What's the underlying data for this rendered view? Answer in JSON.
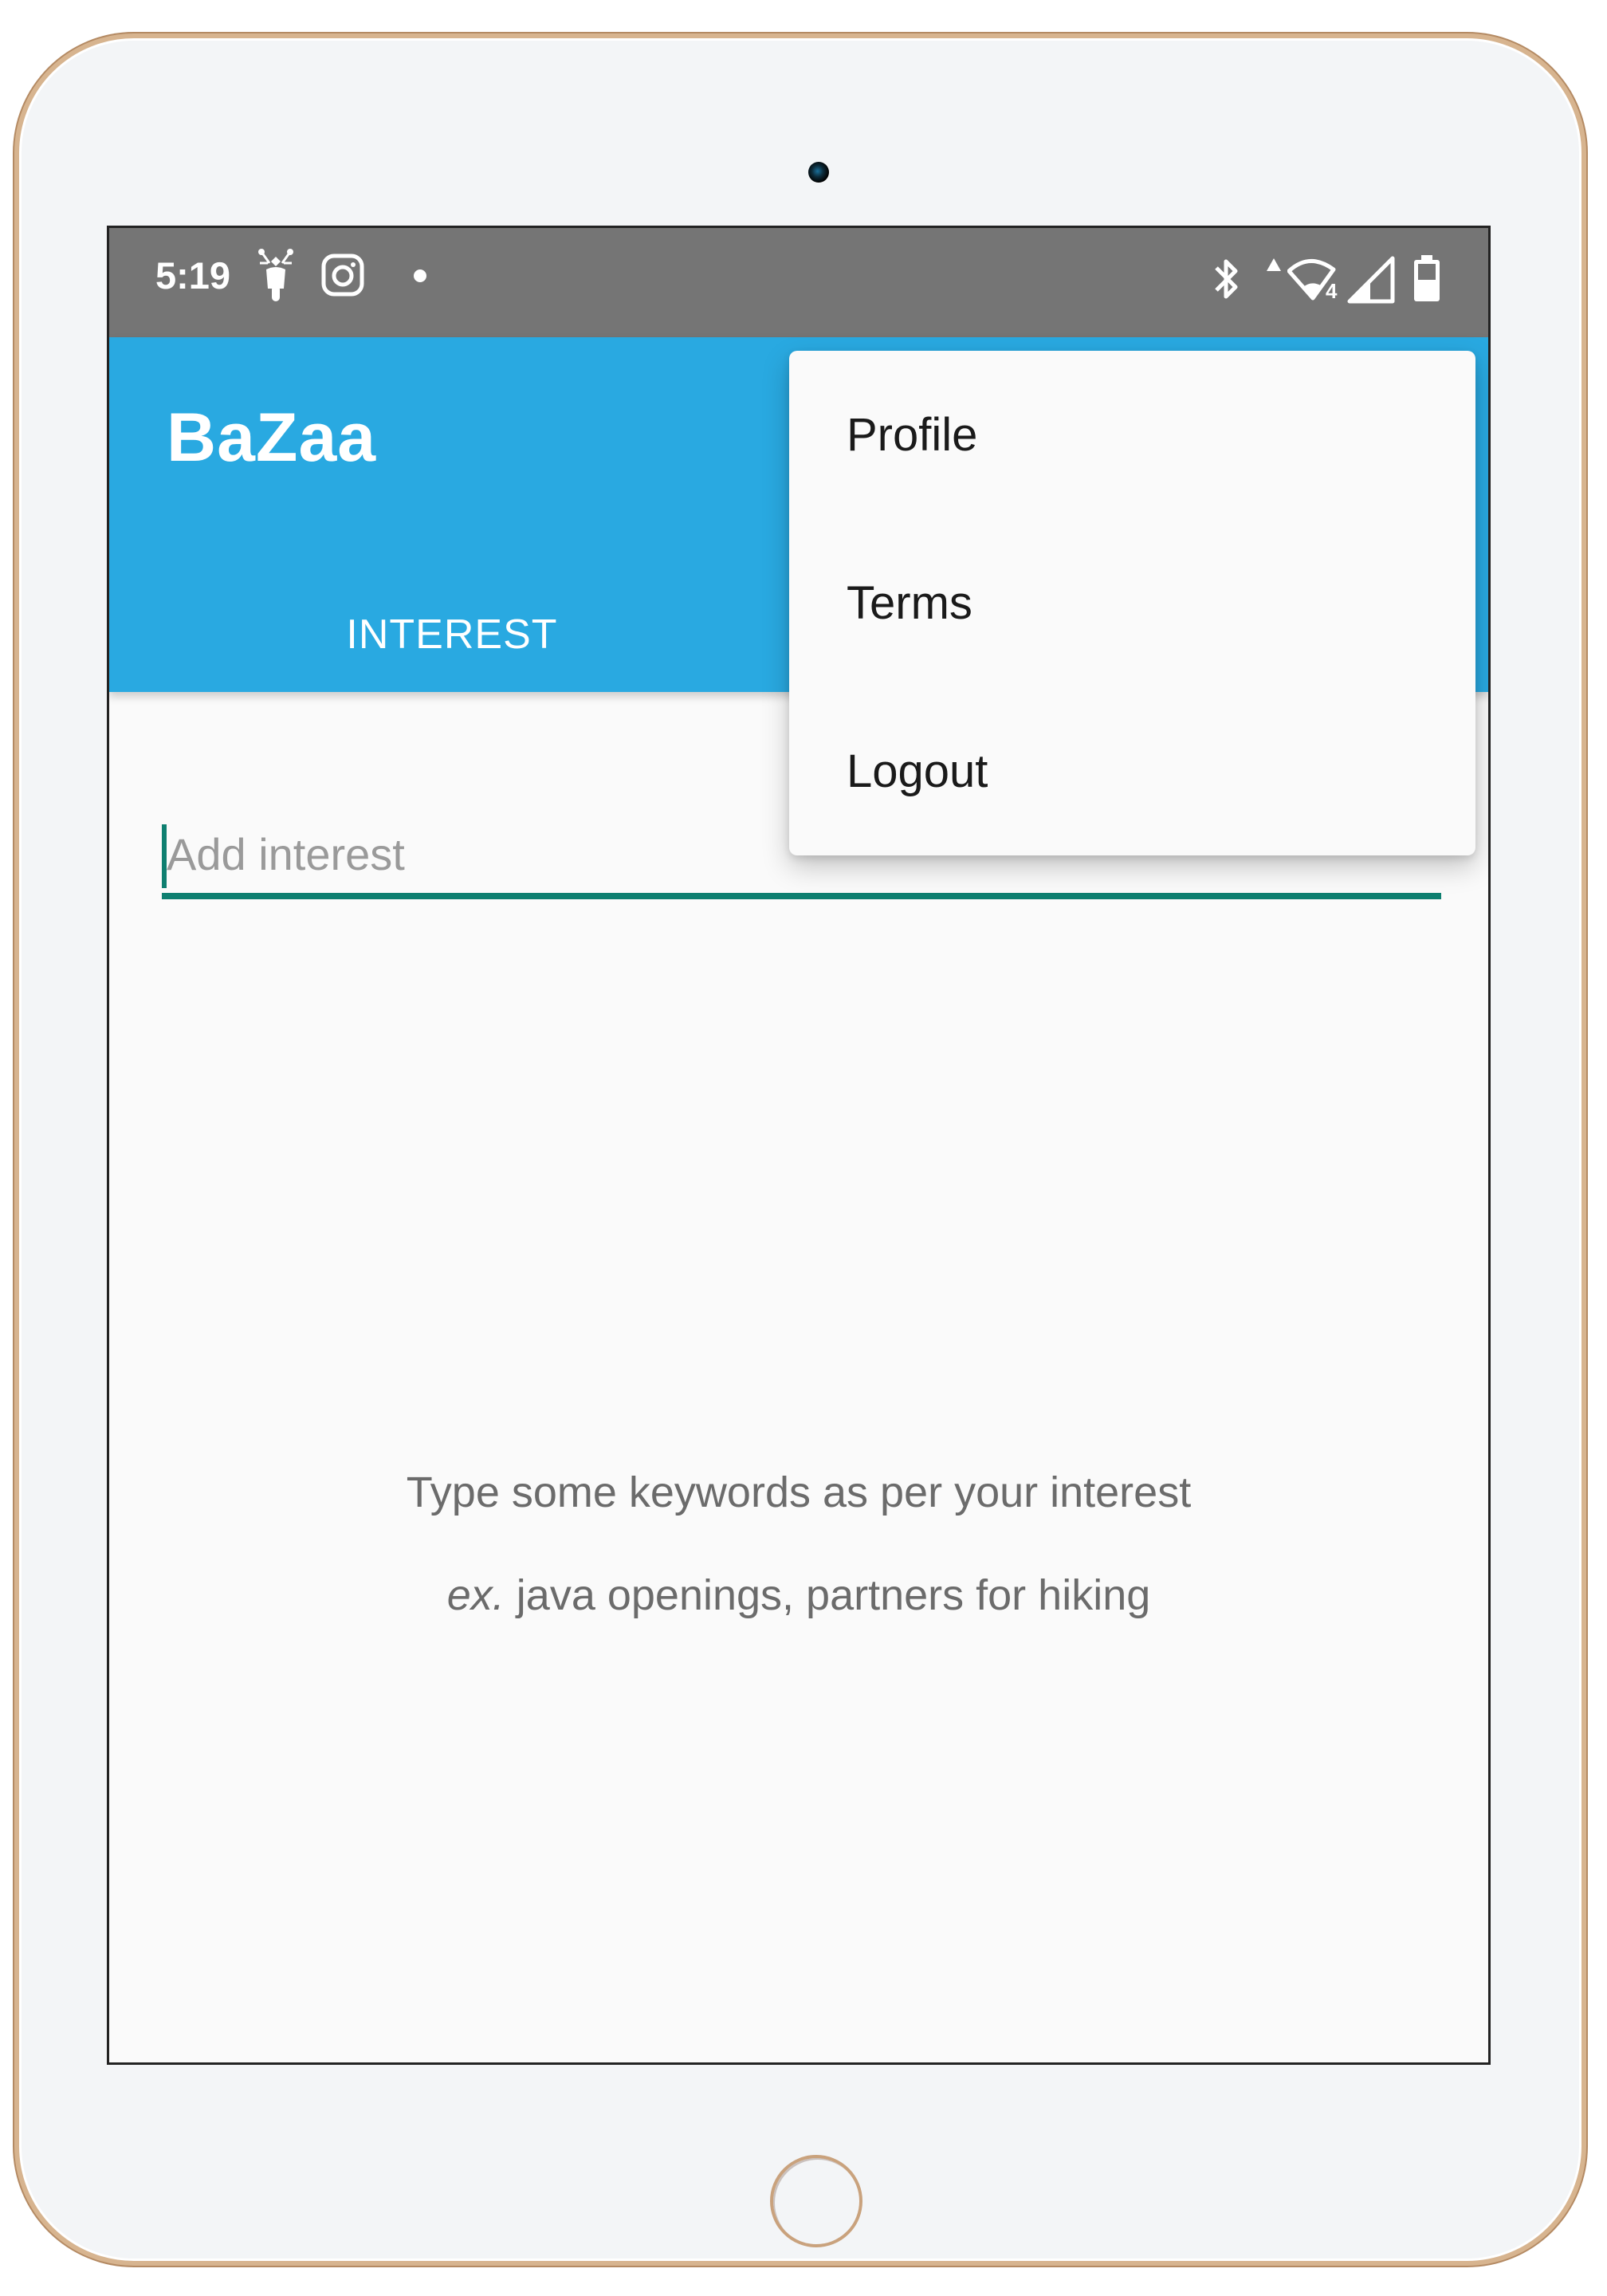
{
  "status_bar": {
    "time": "5:19",
    "left_icons": [
      "scooter-notification-icon",
      "instagram-notification-icon",
      "notification-dot-icon"
    ],
    "right_icons": [
      "bluetooth-icon",
      "data-activity-icon",
      "wifi-icon",
      "cellular-signal-icon",
      "battery-icon"
    ],
    "wifi_badge": "4",
    "background": "#757575"
  },
  "app_bar": {
    "title": "BaZaa",
    "tabs": [
      {
        "label": "INTEREST",
        "active": true
      }
    ],
    "background": "#29A9E1"
  },
  "overflow_menu": {
    "items": [
      {
        "label": "Profile"
      },
      {
        "label": "Terms"
      },
      {
        "label": "Logout"
      }
    ]
  },
  "interest_input": {
    "value": "",
    "placeholder": "Add interest",
    "accent": "#0E7F70"
  },
  "empty_state": {
    "line1": "Type some keywords as per your interest",
    "line2_prefix": "ex.",
    "line2_rest": " java openings, partners for hiking"
  }
}
